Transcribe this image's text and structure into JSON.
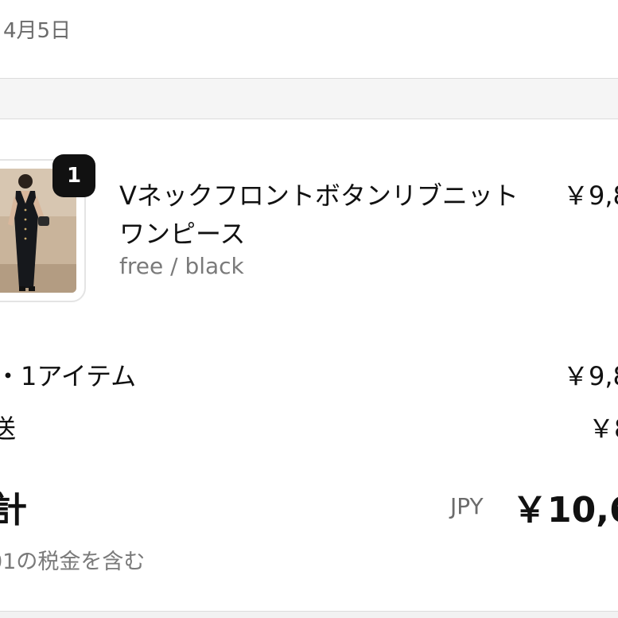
{
  "header": {
    "date": "4月5日"
  },
  "order": {
    "item": {
      "quantity": "1",
      "name": "Vネックフロントボタンリブニットワンピース",
      "variant": "free / black",
      "price": "￥9,8"
    },
    "summary": {
      "subtotal_label": "・1アイテム",
      "subtotal_value": "￥9,8",
      "shipping_label": "送",
      "shipping_value": "￥8",
      "total_label": "計",
      "currency": "JPY",
      "total_value": "￥10,6",
      "tax_note": "01の税金を含む"
    }
  }
}
